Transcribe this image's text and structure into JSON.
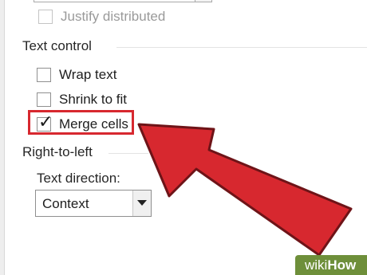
{
  "alignment": {
    "justify_distributed_label": "Justify distributed",
    "justify_distributed_checked": false
  },
  "text_control": {
    "heading": "Text control",
    "options": [
      {
        "label": "Wrap text",
        "checked": false
      },
      {
        "label": "Shrink to fit",
        "checked": false
      },
      {
        "label": "Merge cells",
        "checked": true
      }
    ]
  },
  "right_to_left": {
    "heading": "Right-to-left",
    "text_direction_label": "Text direction:",
    "text_direction_value": "Context"
  },
  "overlay": {
    "arrow_color": "#d7282f",
    "highlight_color": "#d7282f",
    "watermark_prefix": "wiki",
    "watermark_suffix": "How",
    "watermark_color": "#6e8f3a"
  }
}
